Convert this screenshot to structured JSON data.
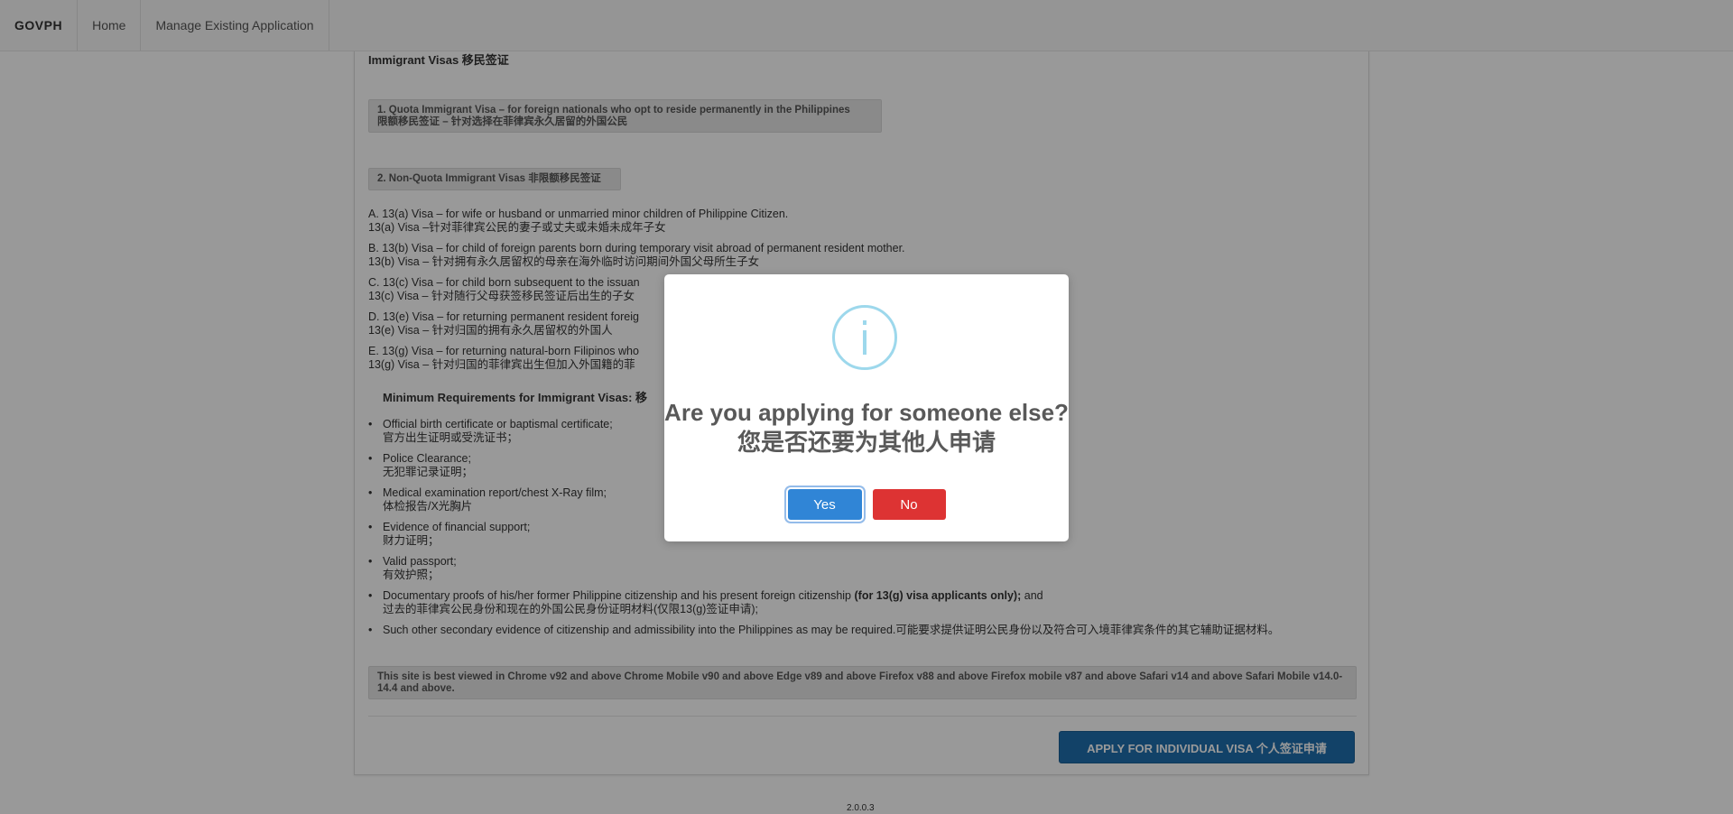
{
  "nav": {
    "brand": "GOVPH",
    "home": "Home",
    "manage": "Manage Existing Application"
  },
  "content": {
    "heading": "Immigrant Visas 移民签证",
    "quota": {
      "line1": "1. Quota Immigrant Visa – for foreign nationals who opt to reside permanently in the Philippines",
      "line2": "限额移民签证 – 针对选择在菲律宾永久居留的外国公民"
    },
    "nonquota": "2. Non-Quota Immigrant Visas 非限额移民签证",
    "visas": [
      {
        "en": "A. 13(a) Visa – for wife or husband or unmarried minor children of Philippine Citizen.",
        "zh": "13(a) Visa –针对菲律宾公民的妻子或丈夫或未婚未成年子女"
      },
      {
        "en": "B. 13(b) Visa – for child of foreign parents born during temporary visit abroad of permanent resident mother.",
        "zh": "13(b) Visa – 针对拥有永久居留权的母亲在海外临时访问期间外国父母所生子女"
      },
      {
        "en": "C. 13(c) Visa – for child born subsequent to the issuan",
        "zh": "13(c) Visa – 针对随行父母获签移民签证后出生的子女"
      },
      {
        "en": "D. 13(e) Visa – for returning permanent resident foreig",
        "zh": "13(e) Visa – 针对归国的拥有永久居留权的外国人"
      },
      {
        "en": "E. 13(g) Visa – for returning natural-born Filipinos who",
        "zh": "13(g) Visa – 针对归国的菲律宾出生但加入外国籍的菲"
      }
    ],
    "min_requirements": "Minimum Requirements for Immigrant Visas: 移",
    "requirements": [
      {
        "en": "Official birth certificate or baptismal certificate;",
        "zh": "官方出生证明或受洗证书；"
      },
      {
        "en": "Police Clearance;",
        "zh": "无犯罪记录证明；"
      },
      {
        "en": "Medical examination report/chest X-Ray film;",
        "zh": "体检报告/X光胸片"
      },
      {
        "en": "Evidence of financial support;",
        "zh": "财力证明；"
      },
      {
        "en": "Valid passport;",
        "zh": "有效护照；"
      }
    ],
    "req_doc": {
      "en_a": "Documentary proofs of his/her former Philippine citizenship and his present foreign citizenship ",
      "en_bold": "(for 13(g) visa applicants only);",
      "en_b": " and",
      "zh": "过去的菲律宾公民身份和现在的外国公民身份证明材料(仅限13(g)签证申请);"
    },
    "req_other": "Such other secondary evidence of citizenship and admissibility into the Philippines as may be required.可能要求提供证明公民身份以及符合可入境菲律宾条件的其它辅助证据材料。",
    "notice": "This site is best viewed in Chrome v92 and above Chrome Mobile v90 and above Edge v89 and above Firefox v88 and above Firefox mobile v87 and above Safari v14 and above Safari Mobile v14.0-14.4 and above.",
    "apply_button": "APPLY FOR INDIVIDUAL VISA 个人签证申请"
  },
  "version": "2.0.0.3",
  "modal": {
    "icon": "info-icon",
    "title": "Are you applying for someone else? 您是否还要为其他人申请",
    "yes": "Yes",
    "no": "No"
  },
  "colors": {
    "yes": "#3085d6",
    "no": "#dd3333",
    "apply": "#1f6fad",
    "info_ring": "#9dd8ec"
  }
}
